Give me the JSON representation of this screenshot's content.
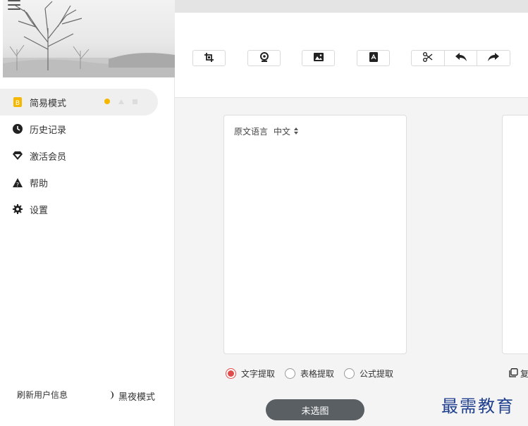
{
  "sidebar": {
    "items": [
      {
        "label": "简易模式",
        "icon": "b-badge-icon",
        "active": true
      },
      {
        "label": "历史记录",
        "icon": "clock-icon"
      },
      {
        "label": "激活会员",
        "icon": "diamond-icon"
      },
      {
        "label": "帮助",
        "icon": "help-triangle-icon"
      },
      {
        "label": "设置",
        "icon": "gear-icon"
      }
    ],
    "refresh_label": "刷新用户信息",
    "night_label": "黑夜模式"
  },
  "toolbar": {
    "buttons": [
      "crop-icon",
      "camera-icon",
      "image-icon",
      "pdf-icon",
      "cut-icon",
      "undo-icon",
      "redo-icon"
    ]
  },
  "source": {
    "label": "原文语言",
    "language": "中文"
  },
  "modes": {
    "options": [
      "文字提取",
      "表格提取",
      "公式提取"
    ],
    "selected": "文字提取"
  },
  "copy_label": "复",
  "select_button": "未选图",
  "watermark": "最需教育",
  "colors": {
    "accent_yellow": "#f5b800",
    "radio_red": "#e04b4b",
    "pill_bg": "#5a5f63",
    "watermark": "#1f3f8f"
  }
}
